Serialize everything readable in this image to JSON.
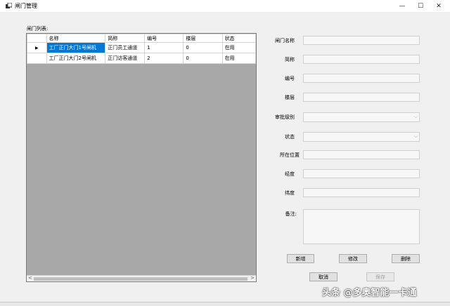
{
  "window": {
    "title": "闸门管理",
    "min_glyph": "—",
    "max_glyph": "☐",
    "close_glyph": "✕"
  },
  "list": {
    "label": "闸门列表:",
    "columns": [
      "名称",
      "简称",
      "编号",
      "楼层",
      "状态"
    ],
    "rows": [
      {
        "marker": "▶",
        "cells": [
          "工厂正门大门1号闸机",
          "正门员工通道",
          "1",
          "0",
          "在用"
        ]
      },
      {
        "marker": "",
        "cells": [
          "工厂正门大门2号闸机",
          "正门访客通道",
          "2",
          "0",
          "在用"
        ]
      }
    ],
    "scroll_left": "<",
    "scroll_right": ">"
  },
  "form": {
    "name_label": "闸门名称",
    "short_label": "简称",
    "number_label": "编号",
    "floor_label": "楼层",
    "approval_label": "审批级别",
    "status_label": "状态",
    "location_label": "所在位置",
    "longitude_label": "经度",
    "latitude_label": "纬度",
    "remark_label": "备注:",
    "name_value": "",
    "short_value": "",
    "number_value": "",
    "floor_value": "",
    "location_value": "",
    "longitude_value": "",
    "latitude_value": "",
    "remark_value": ""
  },
  "buttons": {
    "add": "新增",
    "edit": "修改",
    "delete": "删除",
    "cancel": "取消",
    "save": "保存"
  },
  "watermark": "头条 @多奥智能一卡通"
}
